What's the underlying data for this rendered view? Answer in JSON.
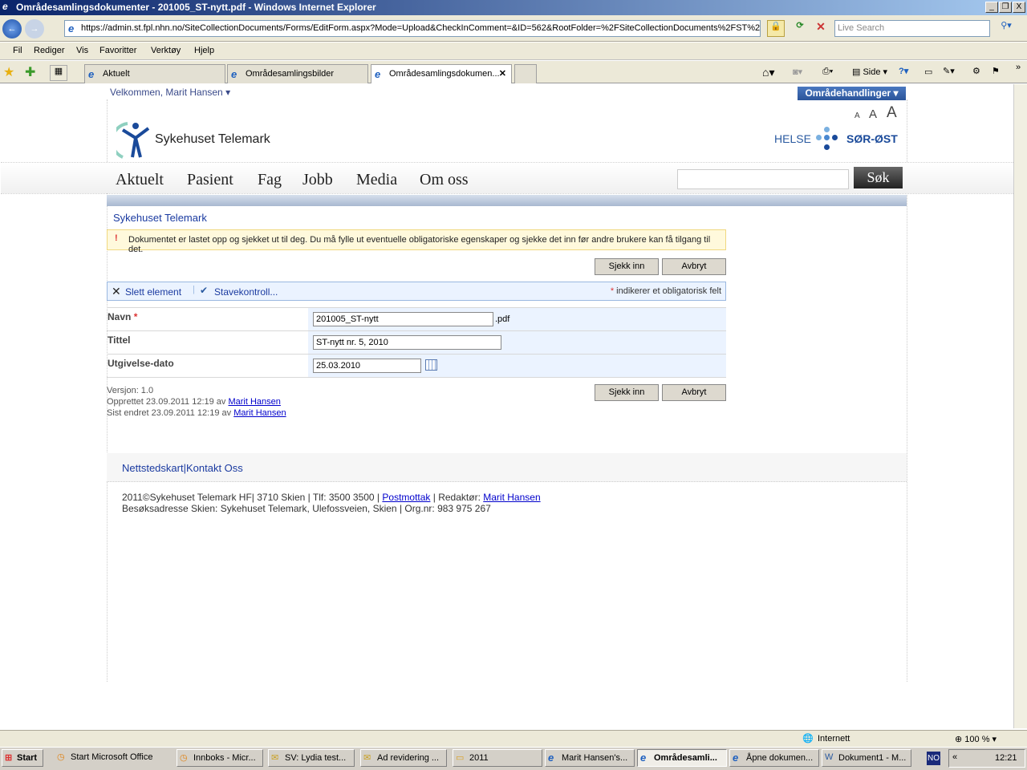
{
  "window": {
    "title": "Områdesamlingsdokumenter - 201005_ST-nytt.pdf - Windows Internet Explorer",
    "controls": [
      "_",
      "❐",
      "X"
    ]
  },
  "browser": {
    "url": "https://admin.st.fpl.nhn.no/SiteCollectionDocuments/Forms/EditForm.aspx?Mode=Upload&CheckInComment=&ID=562&RootFolder=%2FSiteCollectionDocuments%2FST%2",
    "search_placeholder": "Live Search",
    "menu": [
      "Fil",
      "Rediger",
      "Vis",
      "Favoritter",
      "Verktøy",
      "Hjelp"
    ],
    "tabs": [
      {
        "label": "Aktuelt"
      },
      {
        "label": "Områdesamlingsbilder"
      },
      {
        "label": "Områdesamlingsdokumen...",
        "active": true
      }
    ],
    "toolbar": {
      "page_label": "Side"
    }
  },
  "site": {
    "welcome": "Velkommen, Marit Hansen",
    "site_actions": "Områdehandlinger",
    "font_sizes": [
      "A",
      "A",
      "A"
    ],
    "logo_text": "Sykehuset Telemark",
    "partner_logo": {
      "left": "HELSE",
      "right": "SØR-ØST"
    },
    "nav": [
      "Aktuelt",
      "Pasient",
      "Fag",
      "Jobb",
      "Media",
      "Om oss"
    ],
    "search_button": "Søk",
    "breadcrumb": "Sykehuset Telemark"
  },
  "form": {
    "notice": "Dokumentet er lastet opp og sjekket ut til deg. Du må fylle ut eventuelle obligatoriske egenskaper og sjekke det inn før andre brukere kan få tilgang til det.",
    "checkin_label": "Sjekk inn",
    "cancel_label": "Avbryt",
    "delete_label": "Slett element",
    "spell_label": "Stavekontroll...",
    "required_note": "indikerer et obligatorisk felt",
    "required_star": "*",
    "fields": {
      "name_label": "Navn",
      "name_value": "201005_ST-nytt",
      "name_ext": ".pdf",
      "title_label": "Tittel",
      "title_value": "ST-nytt nr.  5, 2010",
      "date_label": "Utgivelse-dato",
      "date_value": "25.03.2010"
    },
    "version": "Versjon: 1.0",
    "created": "Opprettet 23.09.2011 12:19  av",
    "modified": "Sist endret 23.09.2011 12:19  av",
    "author": "Marit Hansen"
  },
  "footer": {
    "sitemap": "Nettstedskart",
    "sep": "|",
    "contact": "Kontakt Oss",
    "line1_a": "2011©Sykehuset Telemark HF| 3710 Skien | Tlf: 3500 3500 |",
    "postmottak": "Postmottak",
    "line1_b": "| Redaktør:",
    "editor": "Marit Hansen",
    "line2": "Besøksadresse Skien: Sykehuset Telemark, Ulefossveien, Skien | Org.nr: 983 975 267"
  },
  "status": {
    "zone": "Internett",
    "zoom": "100 %"
  },
  "taskbar": {
    "start": "Start",
    "items": [
      {
        "label": "Start Microsoft Office"
      },
      {
        "label": "Innboks - Micr..."
      },
      {
        "label": "SV: Lydia test..."
      },
      {
        "label": "Ad revidering ..."
      },
      {
        "label": "2011"
      },
      {
        "label": "Marit Hansen's..."
      },
      {
        "label": "Områdesamli...",
        "active": true
      },
      {
        "label": "Åpne dokumen..."
      },
      {
        "label": "Dokument1 - M..."
      }
    ],
    "lang": "NO",
    "clock": "12:21"
  }
}
